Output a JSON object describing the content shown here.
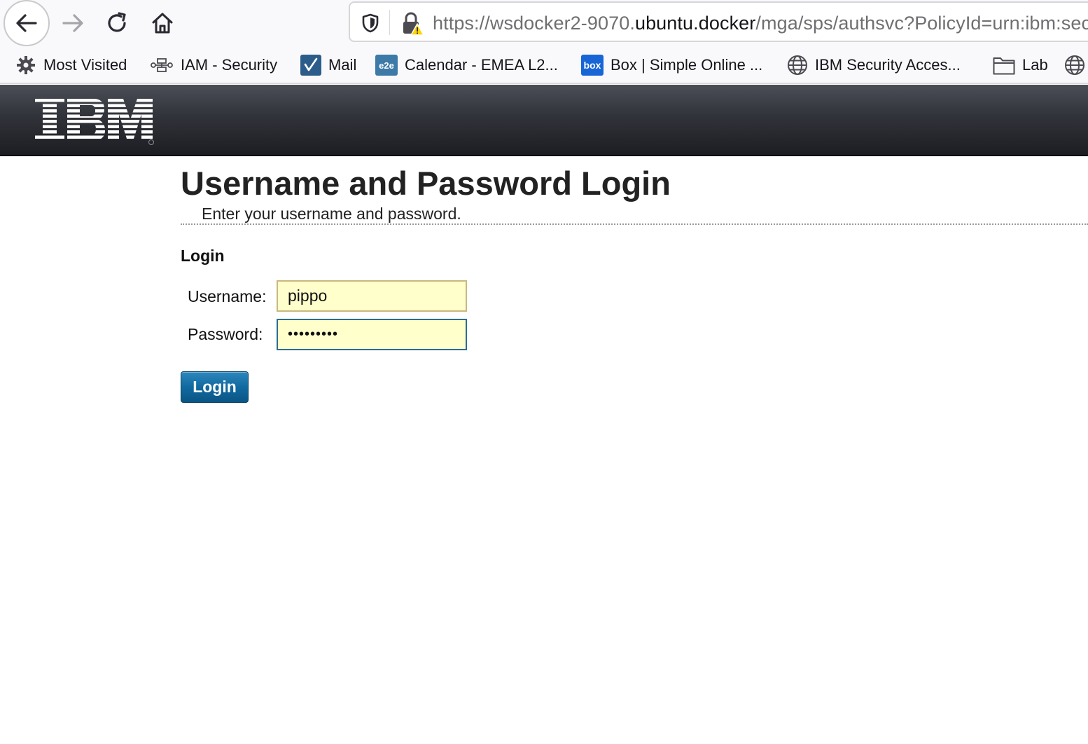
{
  "browser": {
    "url": {
      "scheme_prefix": "https://wsdocker2-9070.",
      "host": "ubuntu.docker",
      "path": "/mga/sps/authsvc?PolicyId=urn:ibm:security:authentication:asf:password"
    },
    "bookmarks": [
      {
        "label": "Most Visited",
        "icon": "gear-icon"
      },
      {
        "label": "IAM - Security",
        "icon": "network-icon"
      },
      {
        "label": "Mail",
        "icon": "mail-app-icon"
      },
      {
        "label": "Calendar - EMEA L2...",
        "icon": "e2e-icon"
      },
      {
        "label": "Box | Simple Online ...",
        "icon": "box-icon"
      },
      {
        "label": "IBM Security Acces...",
        "icon": "globe-icon"
      },
      {
        "label": "Lab",
        "icon": "folder-icon"
      }
    ]
  },
  "banner": {
    "logo": "IBM"
  },
  "page": {
    "title": "Username and Password Login",
    "subtitle": "Enter your username and password.",
    "section_heading": "Login",
    "username_label": "Username:",
    "username_value": "pippo",
    "password_label": "Password:",
    "password_value": "•••••••••",
    "login_button": "Login"
  },
  "colors": {
    "input_background": "#ffffcc",
    "button_blue": "#116aa0",
    "banner_dark": "#31333a"
  }
}
